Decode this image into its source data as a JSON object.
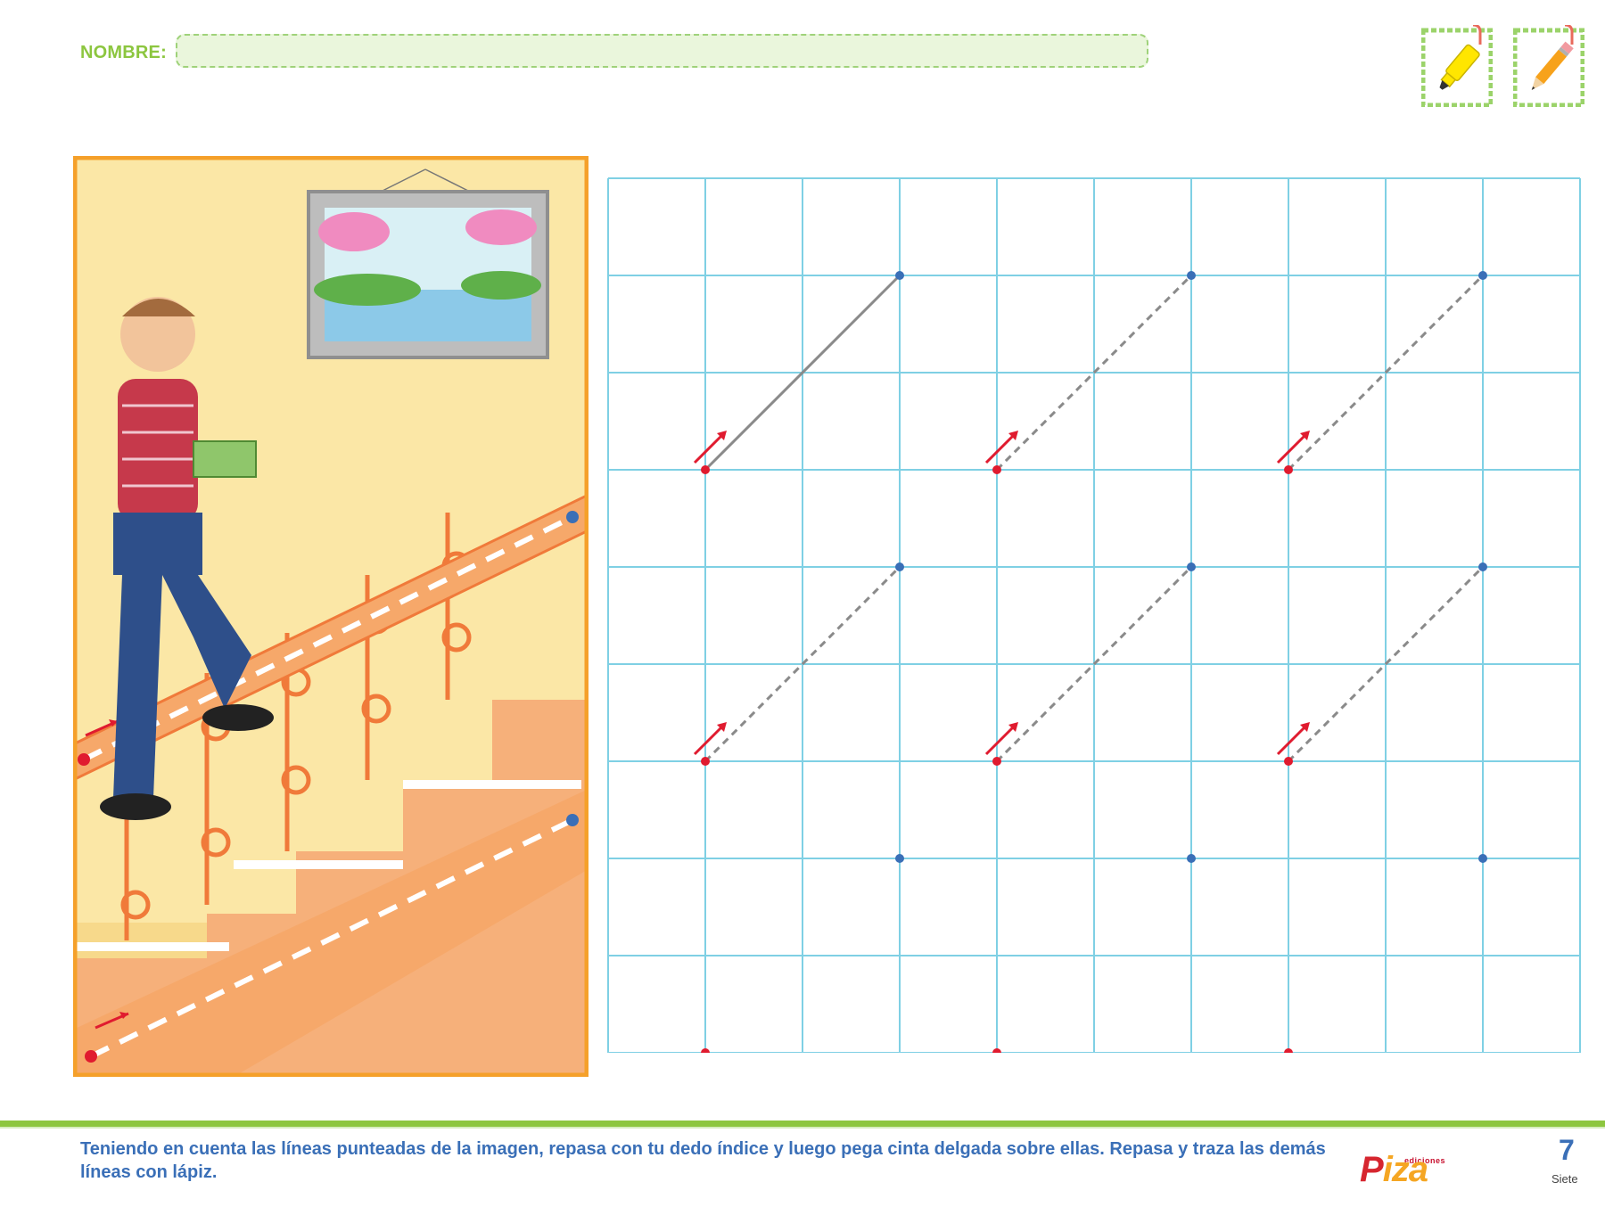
{
  "header": {
    "name_label": "NOMBRE:"
  },
  "tools": [
    {
      "icon": "highlighter-icon",
      "color": "#ffe600"
    },
    {
      "icon": "pencil-icon",
      "color": "#f7a21b"
    }
  ],
  "footer": {
    "instructions": "Teniendo en cuenta las líneas punteadas de la imagen, repasa con tu dedo índice y luego pega cinta delgada sobre ellas. Repasa y traza las demás líneas con lápiz.",
    "brand_small": "ediciones",
    "brand_name_a": "P",
    "brand_name_b": "iza",
    "page_number": "7",
    "page_word": "Siete"
  },
  "colors": {
    "accent_green": "#8cc63f",
    "grid_blue": "#7fd0e4",
    "start_dot": "#e01b2f",
    "end_dot": "#3a6fb7",
    "frame_orange": "#f5a02a"
  }
}
